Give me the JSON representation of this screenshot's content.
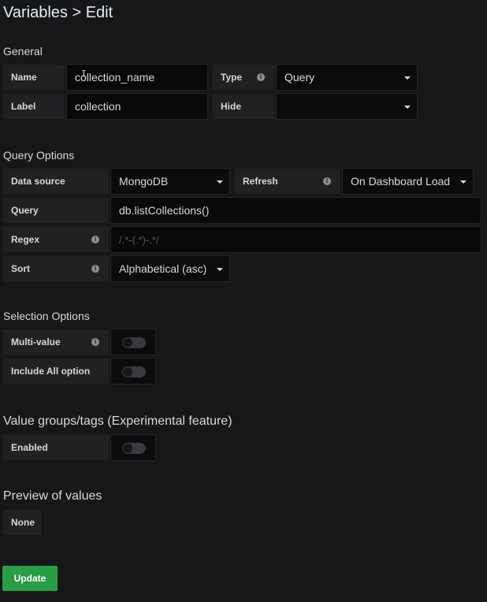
{
  "page": {
    "title": "Variables > Edit"
  },
  "general": {
    "heading": "General",
    "name_label": "Name",
    "name_value": "collection_name",
    "type_label": "Type",
    "type_value": "Query",
    "label_label": "Label",
    "label_value": "collection",
    "hide_label": "Hide",
    "hide_value": ""
  },
  "query_options": {
    "heading": "Query Options",
    "data_source_label": "Data source",
    "data_source_value": "MongoDB",
    "refresh_label": "Refresh",
    "refresh_value": "On Dashboard Load",
    "query_label": "Query",
    "query_value": "db.listCollections()",
    "regex_label": "Regex",
    "regex_placeholder": "/.*-(.*)-.*/",
    "sort_label": "Sort",
    "sort_value": "Alphabetical (asc)"
  },
  "selection_options": {
    "heading": "Selection Options",
    "multi_value_label": "Multi-value",
    "include_all_label": "Include All option"
  },
  "value_groups": {
    "heading": "Value groups/tags (Experimental feature)",
    "enabled_label": "Enabled"
  },
  "preview": {
    "heading": "Preview of values",
    "none_label": "None"
  },
  "actions": {
    "update_label": "Update"
  },
  "icons": {
    "info": "i",
    "text_cursor": "I"
  },
  "colors": {
    "accent_green": "#299c46",
    "background": "#161719"
  }
}
